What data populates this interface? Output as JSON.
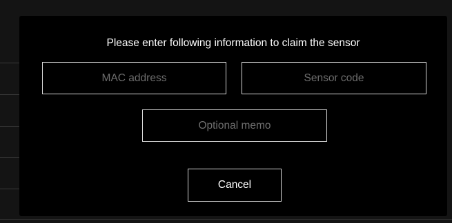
{
  "dialog": {
    "title": "Please enter following information to claim the sensor",
    "fields": {
      "mac_address": {
        "value": "",
        "placeholder": "MAC address"
      },
      "sensor_code": {
        "value": "",
        "placeholder": "Sensor code"
      },
      "memo": {
        "value": "",
        "placeholder": "Optional memo"
      }
    },
    "cancel_label": "Cancel"
  },
  "colors": {
    "backdrop": "#141414",
    "dialog_background": "#000000",
    "border": "#d8d8d8",
    "text": "#ffffff",
    "placeholder": "#6e6e6e"
  }
}
